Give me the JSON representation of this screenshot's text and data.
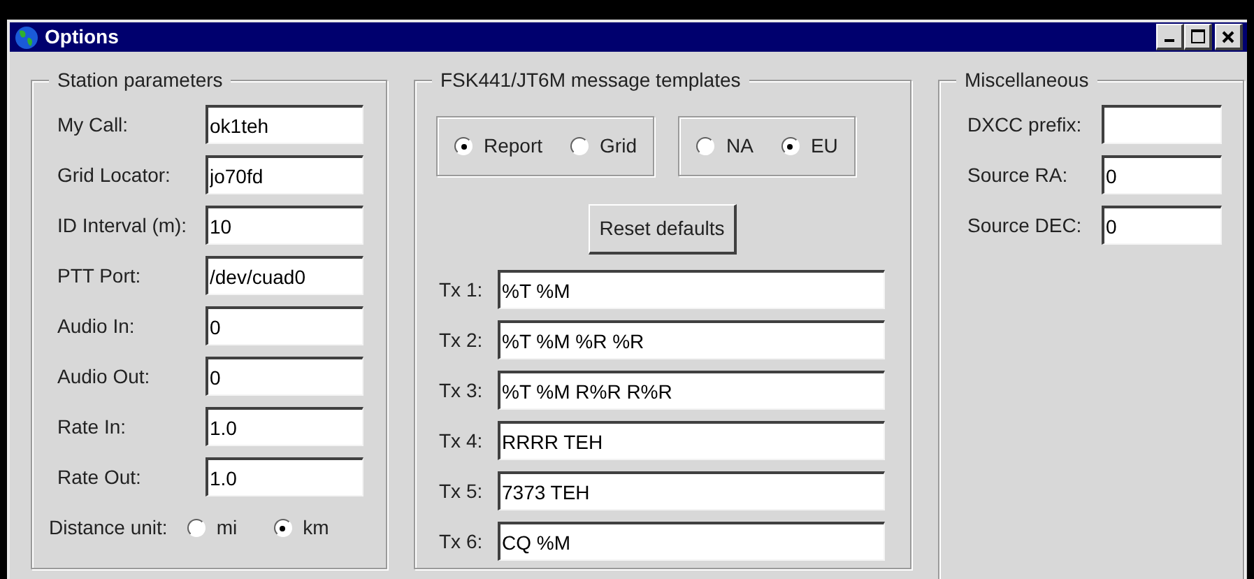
{
  "window": {
    "title": "Options"
  },
  "station": {
    "title": "Station parameters",
    "fields": [
      {
        "label": "My Call:",
        "value": "ok1teh"
      },
      {
        "label": "Grid Locator:",
        "value": "jo70fd"
      },
      {
        "label": "ID Interval (m):",
        "value": "10"
      },
      {
        "label": "PTT Port:",
        "value": "/dev/cuad0"
      },
      {
        "label": "Audio In:",
        "value": "0"
      },
      {
        "label": "Audio Out:",
        "value": "0"
      },
      {
        "label": "Rate In:",
        "value": "1.0"
      },
      {
        "label": "Rate Out:",
        "value": "1.0"
      }
    ],
    "distance": {
      "label": "Distance unit:",
      "options": [
        {
          "label": "mi",
          "selected": false
        },
        {
          "label": "km",
          "selected": true
        }
      ]
    }
  },
  "templates": {
    "title": "FSK441/JT6M message templates",
    "groups": [
      [
        {
          "label": "Report",
          "selected": true
        },
        {
          "label": "Grid",
          "selected": false
        }
      ],
      [
        {
          "label": "NA",
          "selected": false
        },
        {
          "label": "EU",
          "selected": true
        }
      ]
    ],
    "reset_button": "Reset defaults",
    "fields": [
      {
        "label": "Tx 1:",
        "value": "%T %M"
      },
      {
        "label": "Tx 2:",
        "value": "%T %M %R %R"
      },
      {
        "label": "Tx 3:",
        "value": "%T %M R%R R%R"
      },
      {
        "label": "Tx 4:",
        "value": "RRRR TEH"
      },
      {
        "label": "Tx 5:",
        "value": "7373 TEH"
      },
      {
        "label": "Tx 6:",
        "value": "CQ %M"
      }
    ]
  },
  "misc": {
    "title": "Miscellaneous",
    "fields": [
      {
        "label": "DXCC prefix:"
      },
      {
        "label": "Source RA:",
        "value": "0"
      },
      {
        "label": "Source DEC:",
        "value": "0"
      }
    ]
  }
}
